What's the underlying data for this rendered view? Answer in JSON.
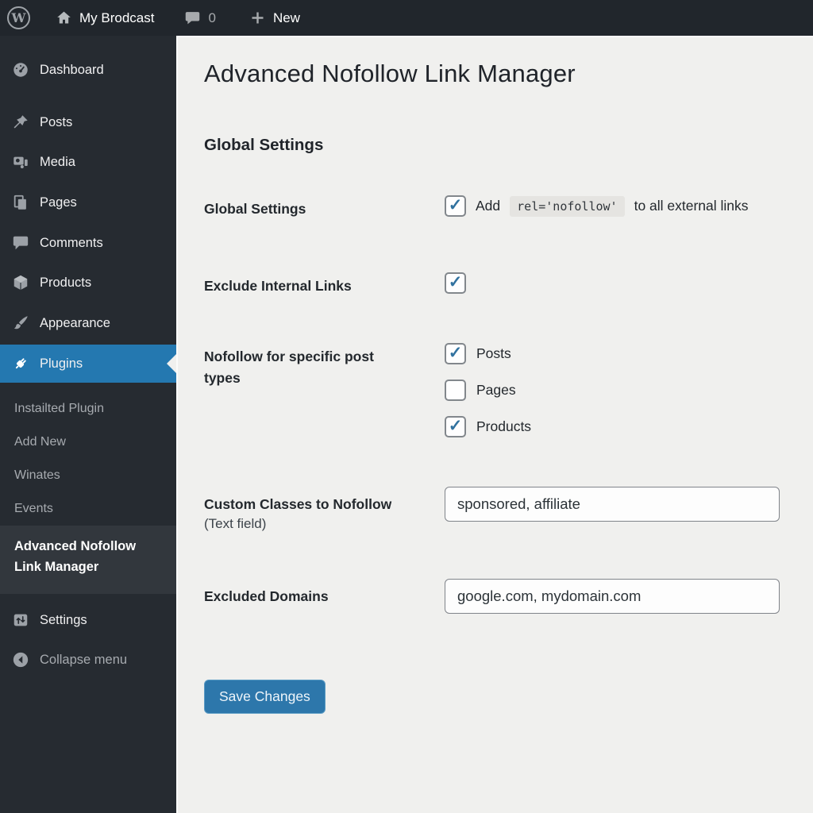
{
  "colors": {
    "admin_bar_bg": "#21262c",
    "sidebar_bg": "#262b31",
    "active_blue": "#2478b0",
    "content_bg": "#f0f0ee",
    "button_bg": "#2d77ab",
    "checkmark": "#31729f"
  },
  "admin_bar": {
    "logo_letter": "W",
    "home_icon": "home-icon",
    "site_name": "My Brodcast",
    "comments_icon": "comment-bubble-icon",
    "comments_count": "0",
    "new_icon": "plus-icon",
    "new_label": "New"
  },
  "sidebar": {
    "items": [
      {
        "label": "Dashboard",
        "icon": "dashboard-gauge-icon"
      },
      {
        "label": "Posts",
        "icon": "pushpin-icon"
      },
      {
        "label": "Media",
        "icon": "camera-icon"
      },
      {
        "label": "Pages",
        "icon": "stacked-pages-icon"
      },
      {
        "label": "Comments",
        "icon": "comment-icon"
      },
      {
        "label": "Products",
        "icon": "cube-icon"
      },
      {
        "label": "Appearance",
        "icon": "paintbrush-icon"
      },
      {
        "label": "Plugins",
        "icon": "plug-icon",
        "active": true
      }
    ],
    "plugins_submenu": [
      {
        "label": "Instailted Plugin"
      },
      {
        "label": "Add New"
      },
      {
        "label": "Winates"
      },
      {
        "label": "Events"
      },
      {
        "label": "Advanced Nofollow Link Manager",
        "active": true
      }
    ],
    "bottom_items": [
      {
        "label": "Settings",
        "icon": "settings-box-icon"
      },
      {
        "label": "Collapse menu",
        "icon": "collapse-arrow-icon"
      }
    ]
  },
  "main": {
    "page_title": "Advanced Nofollow Link Manager",
    "section_heading": "Global Settings",
    "rows": {
      "global": {
        "label": "Global Settings",
        "checkbox_checked": true,
        "text_before": "Add",
        "code": "rel='nofollow'",
        "text_after": "to all external links"
      },
      "exclude_internal": {
        "label": "Exclude Internal Links",
        "checkbox_checked": true
      },
      "post_types": {
        "label": "Nofollow for specific post types",
        "options": [
          {
            "label": "Posts",
            "checked": true
          },
          {
            "label": "Pages",
            "checked": false
          },
          {
            "label": "Products",
            "checked": true
          }
        ]
      },
      "custom_classes": {
        "label": "Custom Classes to Nofollow",
        "sublabel": "(Text field)",
        "value": "sponsored, affiliate"
      },
      "excluded_domains": {
        "label": "Excluded Domains",
        "value": "google.com, mydomain.com"
      }
    },
    "save_button": "Save Changes"
  }
}
